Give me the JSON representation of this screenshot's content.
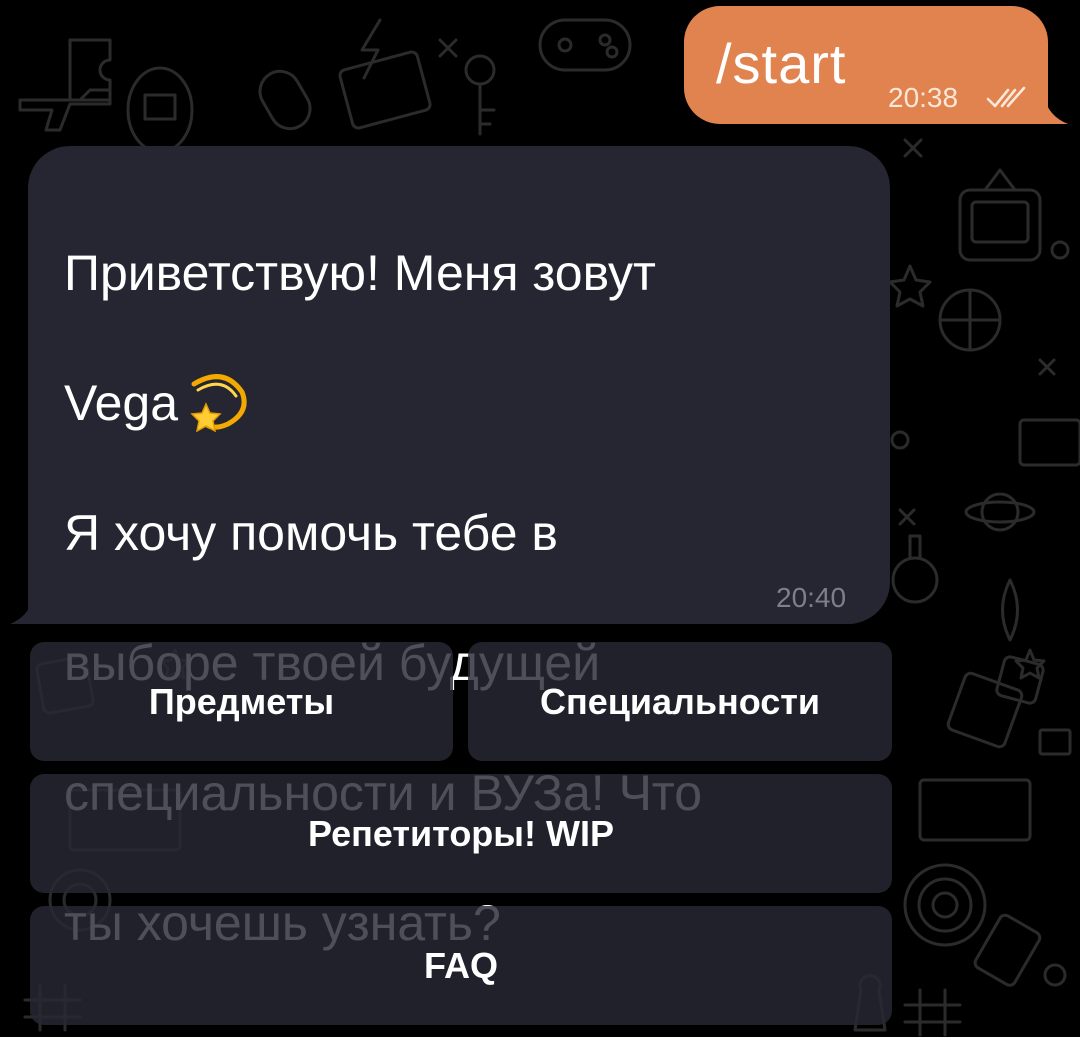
{
  "outgoing_message": {
    "text": "/start",
    "time": "20:38",
    "status_icon": "double-check-icon"
  },
  "incoming_message": {
    "lines": [
      "Приветствую! Меня зовут",
      "Vega",
      "Я хочу помочь тебе в",
      "выборе твоей будущей",
      "специальности и ВУЗа! Что",
      "ты хочешь узнать?"
    ],
    "emoji": "dizzy-star-emoji",
    "time": "20:40"
  },
  "keyboard": {
    "subjects": "Предметы",
    "specialties": "Специальности",
    "tutors": "Репетиторы! WIP",
    "faq": "FAQ"
  },
  "colors": {
    "background": "#000000",
    "outgoing_bubble": "#e0834e",
    "incoming_bubble": "#262632",
    "keyboard_button": "#282834"
  }
}
